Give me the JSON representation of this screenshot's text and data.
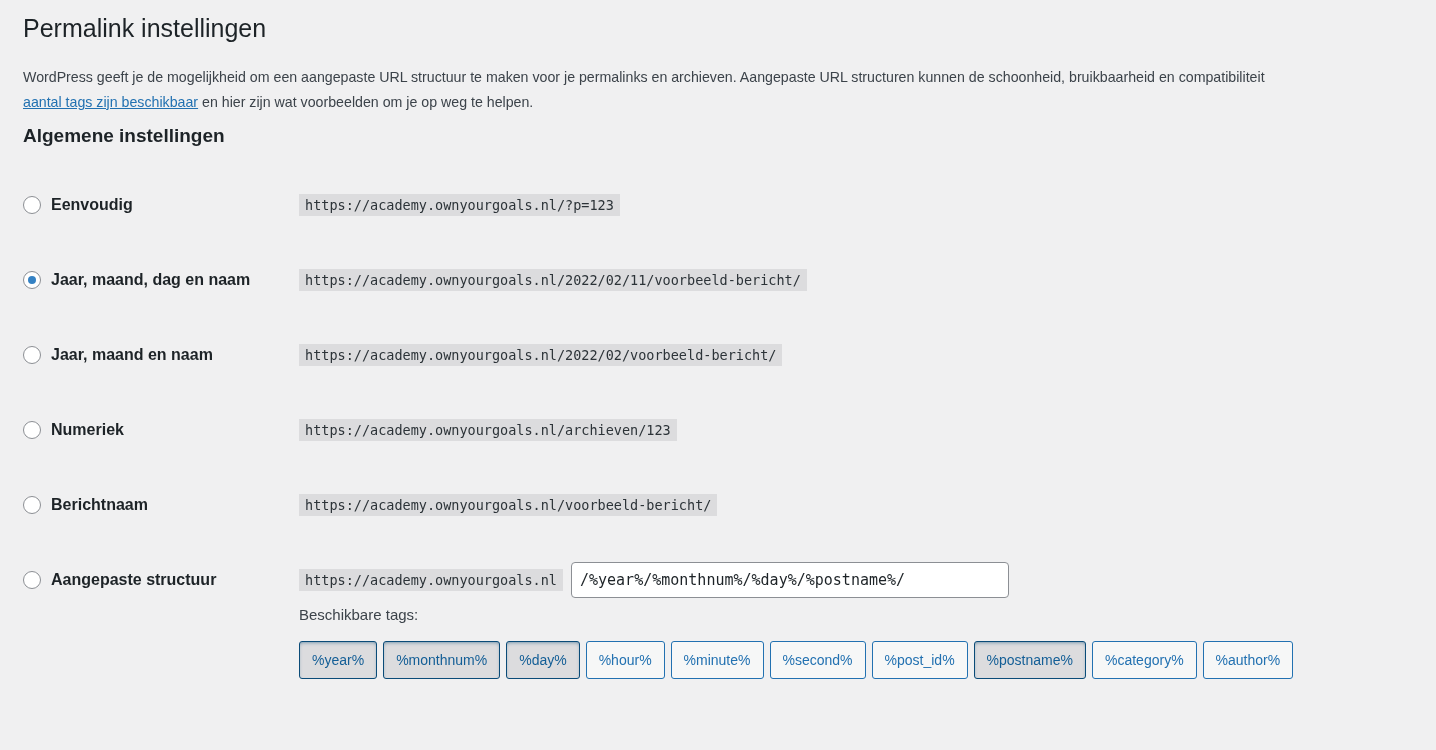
{
  "title": "Permalink instellingen",
  "intro": {
    "text": "WordPress geeft je de mogelijkheid om een aangepaste URL structuur te maken voor je permalinks en archieven. Aangepaste URL structuren kunnen de schoonheid, bruikbaarheid en compatibiliteit",
    "link": "aantal tags zijn beschikbaar",
    "rest": " en hier zijn wat voorbeelden om je op weg te helpen."
  },
  "section_title": "Algemene instellingen",
  "options": [
    {
      "label": "Eenvoudig",
      "selected": false,
      "example": "https://academy.ownyourgoals.nl/?p=123"
    },
    {
      "label": "Jaar, maand, dag en naam",
      "selected": true,
      "example": "https://academy.ownyourgoals.nl/2022/02/11/voorbeeld-bericht/"
    },
    {
      "label": "Jaar, maand en naam",
      "selected": false,
      "example": "https://academy.ownyourgoals.nl/2022/02/voorbeeld-bericht/"
    },
    {
      "label": "Numeriek",
      "selected": false,
      "example": "https://academy.ownyourgoals.nl/archieven/123"
    },
    {
      "label": "Berichtnaam",
      "selected": false,
      "example": "https://academy.ownyourgoals.nl/voorbeeld-bericht/"
    },
    {
      "label": "Aangepaste structuur",
      "selected": false,
      "example": "https://academy.ownyourgoals.nl",
      "value": "/%year%/%monthnum%/%day%/%postname%/"
    }
  ],
  "tags_label": "Beschikbare tags:",
  "tags": [
    {
      "label": "%year%",
      "selected": true
    },
    {
      "label": "%monthnum%",
      "selected": true
    },
    {
      "label": "%day%",
      "selected": true
    },
    {
      "label": "%hour%",
      "selected": false
    },
    {
      "label": "%minute%",
      "selected": false
    },
    {
      "label": "%second%",
      "selected": false
    },
    {
      "label": "%post_id%",
      "selected": false
    },
    {
      "label": "%postname%",
      "selected": true
    },
    {
      "label": "%category%",
      "selected": false
    },
    {
      "label": "%author%",
      "selected": false
    }
  ]
}
